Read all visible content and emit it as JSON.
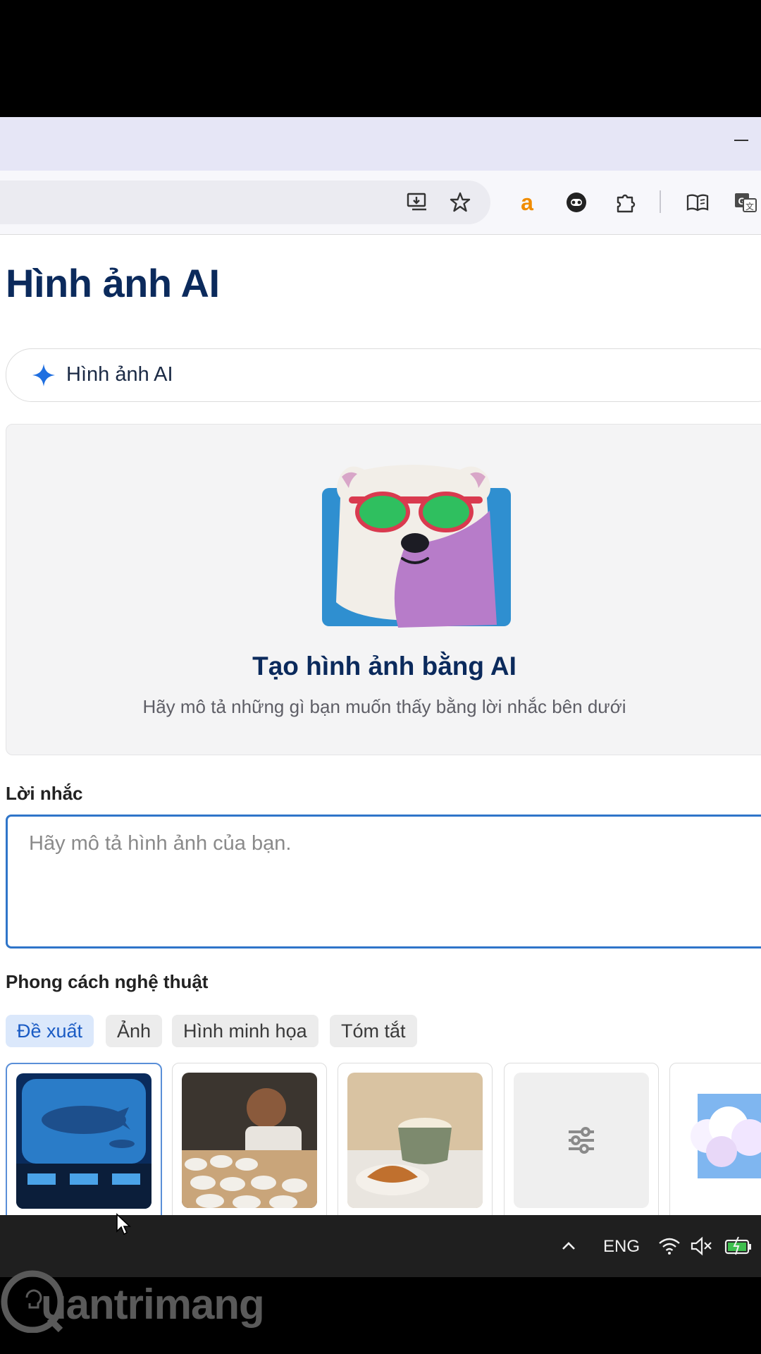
{
  "browser": {
    "toolbar_icons": [
      "install-app-icon",
      "bookmark-star-icon",
      "amazon-extension-icon",
      "extension-circle-icon",
      "extensions-puzzle-icon",
      "reading-mode-icon",
      "translate-icon"
    ]
  },
  "page": {
    "title": "Hình ảnh AI",
    "tool_chip": {
      "icon": "sparkle-icon",
      "label": "Hình ảnh AI"
    },
    "hero": {
      "title": "Tạo hình ảnh bằng AI",
      "subtitle": "Hãy mô tả những gì bạn muốn thấy bằng lời nhắc bên dưới"
    },
    "prompt": {
      "label": "Lời nhắc",
      "placeholder": "Hãy mô tả hình ảnh của bạn."
    },
    "art_style": {
      "label": "Phong cách nghệ thuật",
      "tabs": [
        {
          "label": "Đề xuất",
          "active": true
        },
        {
          "label": "Ảnh",
          "active": false
        },
        {
          "label": "Hình minh họa",
          "active": false
        },
        {
          "label": "Tóm tắt",
          "active": false
        }
      ],
      "cards": [
        "underwater-whale-thumbnail",
        "tea-tasting-thumbnail",
        "latte-croissant-thumbnail",
        "custom-settings-thumbnail",
        "clouds-thumbnail"
      ]
    }
  },
  "taskbar": {
    "language": "ENG",
    "icons": [
      "chevron-up-icon",
      "wifi-icon",
      "speaker-muted-icon",
      "battery-charging-icon"
    ]
  },
  "watermark": {
    "text": "uantrimang"
  },
  "colors": {
    "accent": "#2f75c9",
    "title": "#0b2a5c",
    "active_chip_bg": "#dbe8fb"
  }
}
